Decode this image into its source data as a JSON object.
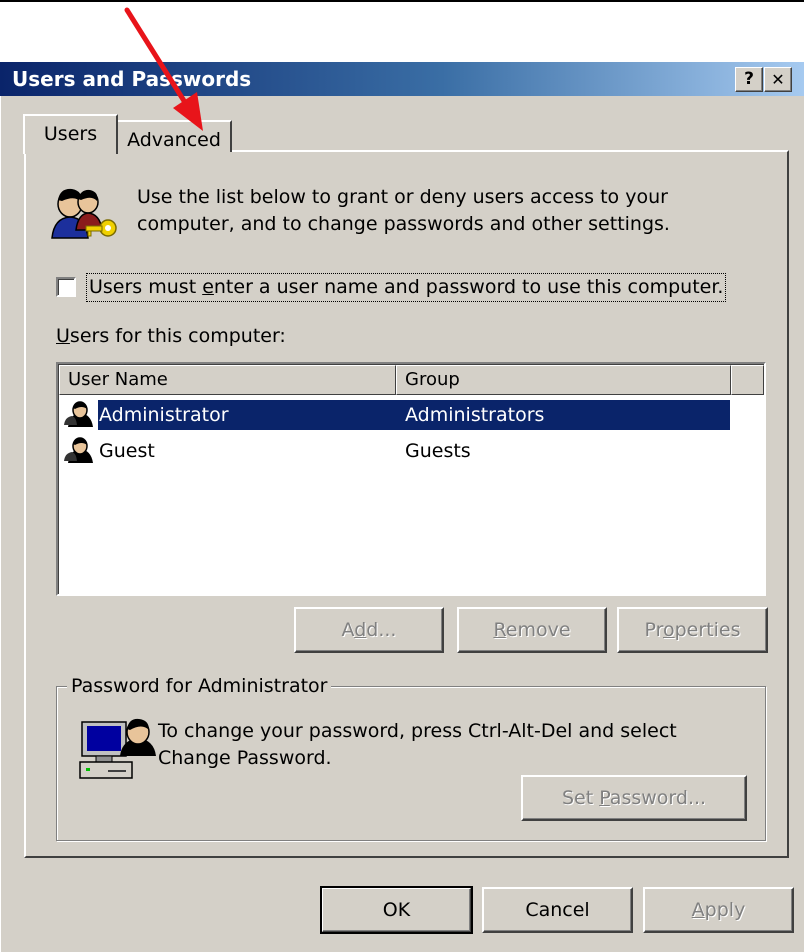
{
  "window": {
    "title": "Users and Passwords",
    "help_button": "?",
    "close_button": "✕"
  },
  "tabs": [
    {
      "label": "Users",
      "selected": true
    },
    {
      "label": "Advanced",
      "selected": false
    }
  ],
  "intro_text": {
    "line1": "Use the list below to grant or deny users access to your",
    "line2": "computer, and to change passwords and other settings."
  },
  "login_checkbox": {
    "checked": false,
    "label_pre": "Users must ",
    "label_accel": "e",
    "label_post": "nter a user name and password to use this computer."
  },
  "users_list": {
    "label_accel": "U",
    "label_rest": "sers for this computer:",
    "columns": [
      "User Name",
      "Group"
    ],
    "rows": [
      {
        "name": "Administrator",
        "group": "Administrators",
        "selected": true
      },
      {
        "name": "Guest",
        "group": "Guests",
        "selected": false
      }
    ]
  },
  "list_buttons": {
    "add": {
      "pre": "A",
      "accel": "d",
      "post": "d...",
      "enabled": false
    },
    "remove": {
      "pre": "",
      "accel": "R",
      "post": "emove",
      "enabled": false
    },
    "properties": {
      "pre": "Pr",
      "accel": "o",
      "post": "perties",
      "enabled": false
    }
  },
  "password_group": {
    "title": "Password for Administrator",
    "line1": "To change your password, press Ctrl-Alt-Del and select",
    "line2": "Change Password.",
    "set_password": {
      "pre": "Set ",
      "accel": "P",
      "post": "assword...",
      "enabled": false
    }
  },
  "dialog_buttons": {
    "ok": "OK",
    "cancel": "Cancel",
    "apply": {
      "pre": "",
      "accel": "A",
      "post": "pply",
      "enabled": false
    }
  },
  "annotation": {
    "arrow_color": "#e8141a",
    "pointing_to": "Advanced tab"
  },
  "colors": {
    "titlebar_start": "#0a246a",
    "titlebar_end": "#a6caf0",
    "selection": "#0a246a",
    "face": "#d4d0c8"
  }
}
